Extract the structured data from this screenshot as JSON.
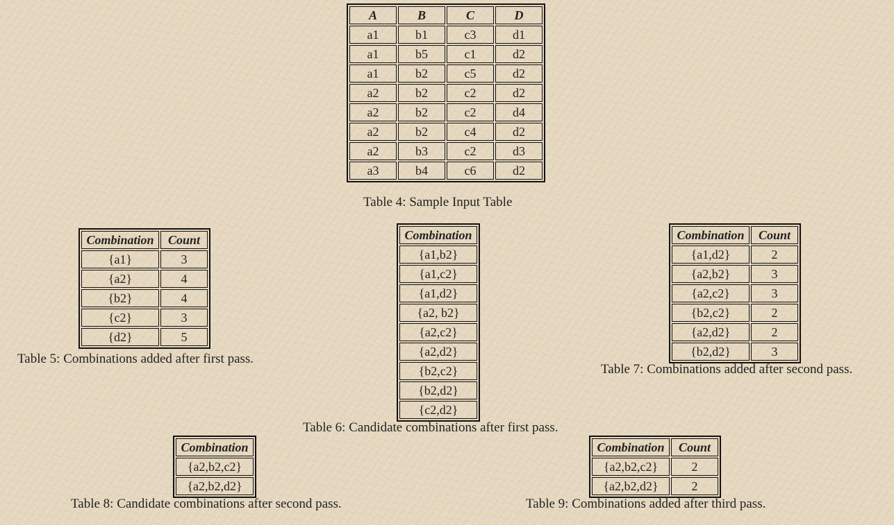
{
  "table4": {
    "caption": "Table 4: Sample Input Table",
    "headers": [
      "A",
      "B",
      "C",
      "D"
    ],
    "rows": [
      [
        "a1",
        "b1",
        "c3",
        "d1"
      ],
      [
        "a1",
        "b5",
        "c1",
        "d2"
      ],
      [
        "a1",
        "b2",
        "c5",
        "d2"
      ],
      [
        "a2",
        "b2",
        "c2",
        "d2"
      ],
      [
        "a2",
        "b2",
        "c2",
        "d4"
      ],
      [
        "a2",
        "b2",
        "c4",
        "d2"
      ],
      [
        "a2",
        "b3",
        "c2",
        "d3"
      ],
      [
        "a3",
        "b4",
        "c6",
        "d2"
      ]
    ]
  },
  "table5": {
    "caption": "Table 5: Combinations added after first pass.",
    "headers": [
      "Combination",
      "Count"
    ],
    "rows": [
      [
        "{a1}",
        "3"
      ],
      [
        "{a2}",
        "4"
      ],
      [
        "{b2}",
        "4"
      ],
      [
        "{c2}",
        "3"
      ],
      [
        "{d2}",
        "5"
      ]
    ]
  },
  "table6": {
    "caption": "Table 6: Candidate combinations after first pass.",
    "headers": [
      "Combination"
    ],
    "rows": [
      [
        "{a1,b2}"
      ],
      [
        "{a1,c2}"
      ],
      [
        "{a1,d2}"
      ],
      [
        "{a2, b2}"
      ],
      [
        "{a2,c2}"
      ],
      [
        "{a2,d2}"
      ],
      [
        "{b2,c2}"
      ],
      [
        "{b2,d2}"
      ],
      [
        "{c2,d2}"
      ]
    ]
  },
  "table7": {
    "caption": "Table 7: Combinations added after second pass.",
    "headers": [
      "Combination",
      "Count"
    ],
    "rows": [
      [
        "{a1,d2}",
        "2"
      ],
      [
        "{a2,b2}",
        "3"
      ],
      [
        "{a2,c2}",
        "3"
      ],
      [
        "{b2,c2}",
        "2"
      ],
      [
        "{a2,d2}",
        "2"
      ],
      [
        "{b2,d2}",
        "3"
      ]
    ]
  },
  "table8": {
    "caption": "Table 8: Candidate combinations after second pass.",
    "headers": [
      "Combination"
    ],
    "rows": [
      [
        "{a2,b2,c2}"
      ],
      [
        "{a2,b2,d2}"
      ]
    ]
  },
  "table9": {
    "caption": "Table 9: Combinations added after third pass.",
    "headers": [
      "Combination",
      "Count"
    ],
    "rows": [
      [
        "{a2,b2,c2}",
        "2"
      ],
      [
        "{a2,b2,d2}",
        "2"
      ]
    ]
  }
}
